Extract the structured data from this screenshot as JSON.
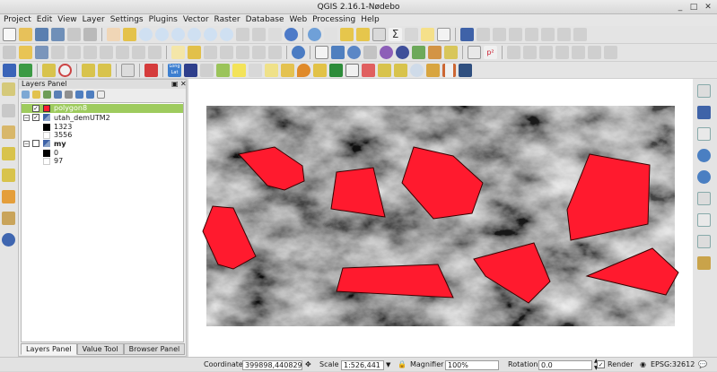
{
  "window": {
    "title": "QGIS 2.16.1-Nødebo"
  },
  "menu": [
    "Project",
    "Edit",
    "View",
    "Layer",
    "Settings",
    "Plugins",
    "Vector",
    "Raster",
    "Database",
    "Web",
    "Processing",
    "Help"
  ],
  "layers_panel": {
    "title": "Layers Panel",
    "layers": [
      {
        "name": "polygon8",
        "checked": true,
        "selected": true
      },
      {
        "name": "utah_demUTM2",
        "checked": true,
        "legend": [
          "1323",
          "3556"
        ]
      },
      {
        "name": "my",
        "checked": false,
        "legend": [
          "0",
          "97"
        ]
      }
    ],
    "tabs": [
      "Layers Panel",
      "Value Tool",
      "Browser Panel"
    ]
  },
  "status": {
    "coordinate_label": "Coordinate",
    "coordinate_value": "399898,4408299",
    "scale_label": "Scale",
    "scale_value": "1:526,441",
    "magnifier_label": "Magnifier",
    "magnifier_value": "100%",
    "rotation_label": "Rotation",
    "rotation_value": "0.0",
    "render_label": "Render",
    "render_checked": true,
    "crs": "EPSG:32612"
  },
  "colors": {
    "polygon_fill": "#ff1a2e",
    "polygon_stroke": "#3a0000",
    "selection": "#9ecb5e"
  }
}
